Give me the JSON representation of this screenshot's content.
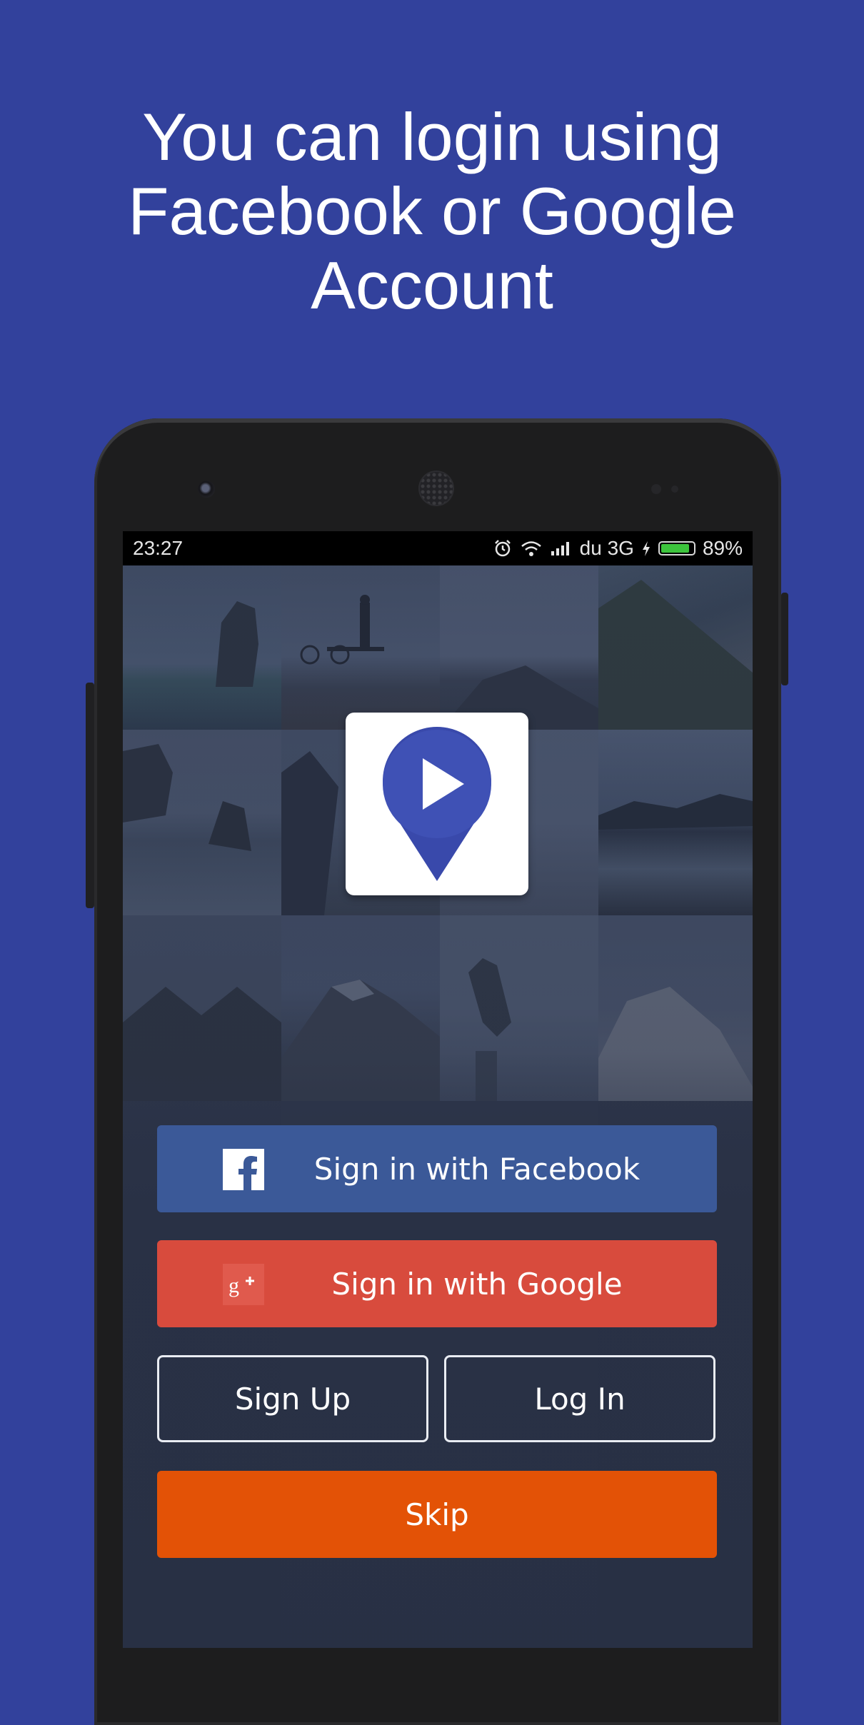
{
  "headline": {
    "line1": "You can login using",
    "line2": "Facebook or Google",
    "line3": "Account"
  },
  "status_bar": {
    "time": "23:27",
    "carrier": "du 3G",
    "battery_percent": "89%",
    "battery_level": 0.89,
    "icons": [
      "alarm-icon",
      "wifi-icon",
      "signal-icon",
      "charging-icon",
      "battery-icon"
    ]
  },
  "app_logo": {
    "icon": "play-location-pin-icon",
    "color": "#3f51b5"
  },
  "buttons": {
    "facebook": "Sign in with Facebook",
    "google": "Sign in with Google",
    "sign_up": "Sign Up",
    "log_in": "Log In",
    "skip": "Skip"
  },
  "colors": {
    "background": "#32419c",
    "facebook": "#3b5998",
    "google": "#d84b3d",
    "skip": "#e35206"
  }
}
